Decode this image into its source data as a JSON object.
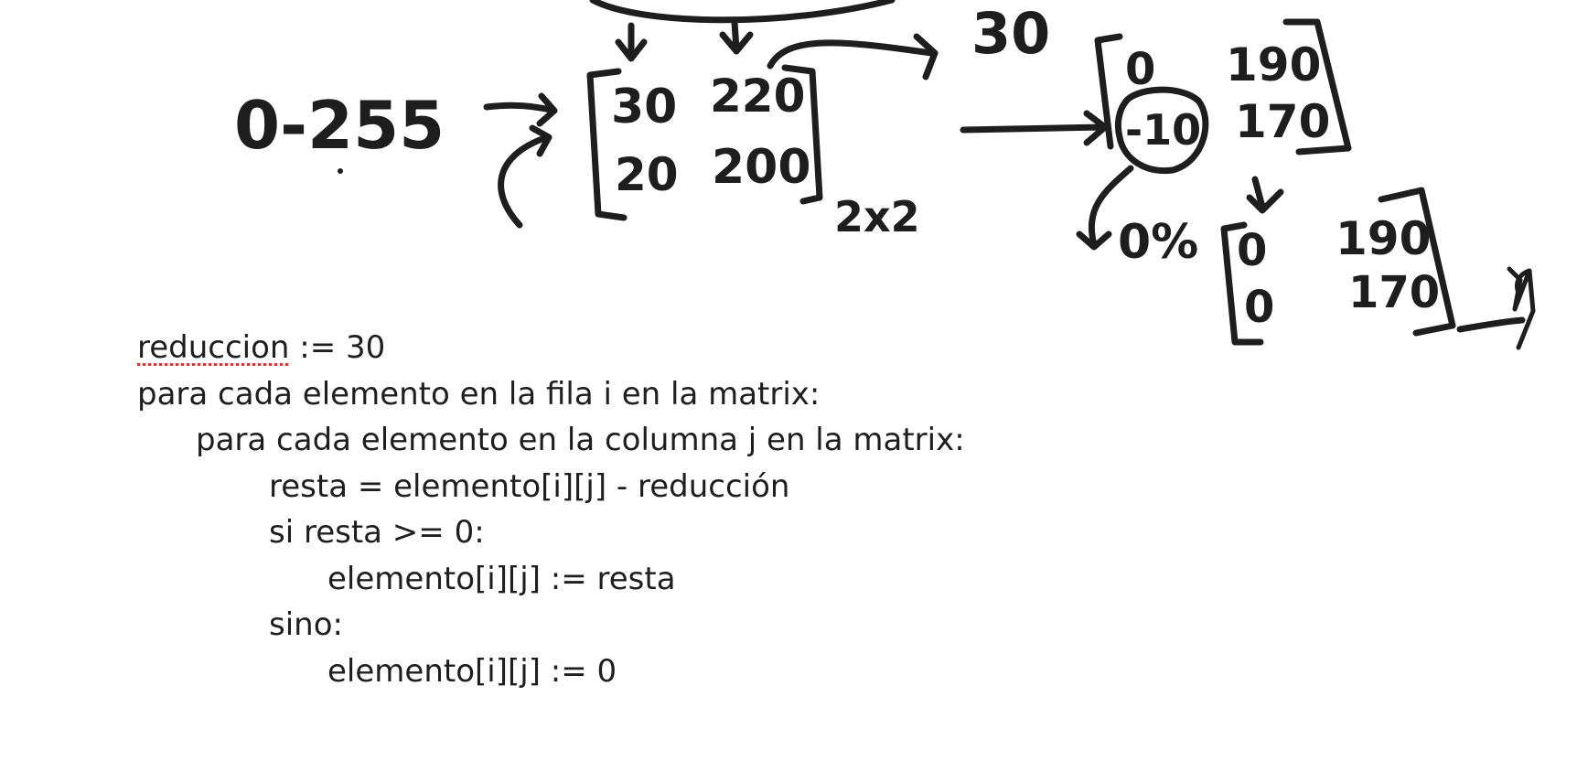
{
  "sketch": {
    "range_label": "0-255",
    "matrix_a": {
      "values": [
        "30",
        "220",
        "20",
        "200"
      ],
      "size_label": "2x2"
    },
    "reduction_label": "30",
    "matrix_b": {
      "values": [
        "0",
        "190",
        "-10",
        "170"
      ]
    },
    "percent_label": "0%",
    "matrix_c": {
      "values": [
        "0",
        "190",
        "0",
        "170"
      ]
    }
  },
  "pseudocode": {
    "line1_word": "reduccion",
    "line1_rest": " := 30",
    "line2": "para cada elemento en la fila i en la matrix:",
    "line3": "para cada elemento en la columna j en la matrix:",
    "line4": "resta = elemento[i][j] - reducción",
    "line5": "si resta >= 0:",
    "line6": "elemento[i][j] := resta",
    "line7": "sino:",
    "line8": "elemento[i][j] := 0"
  }
}
